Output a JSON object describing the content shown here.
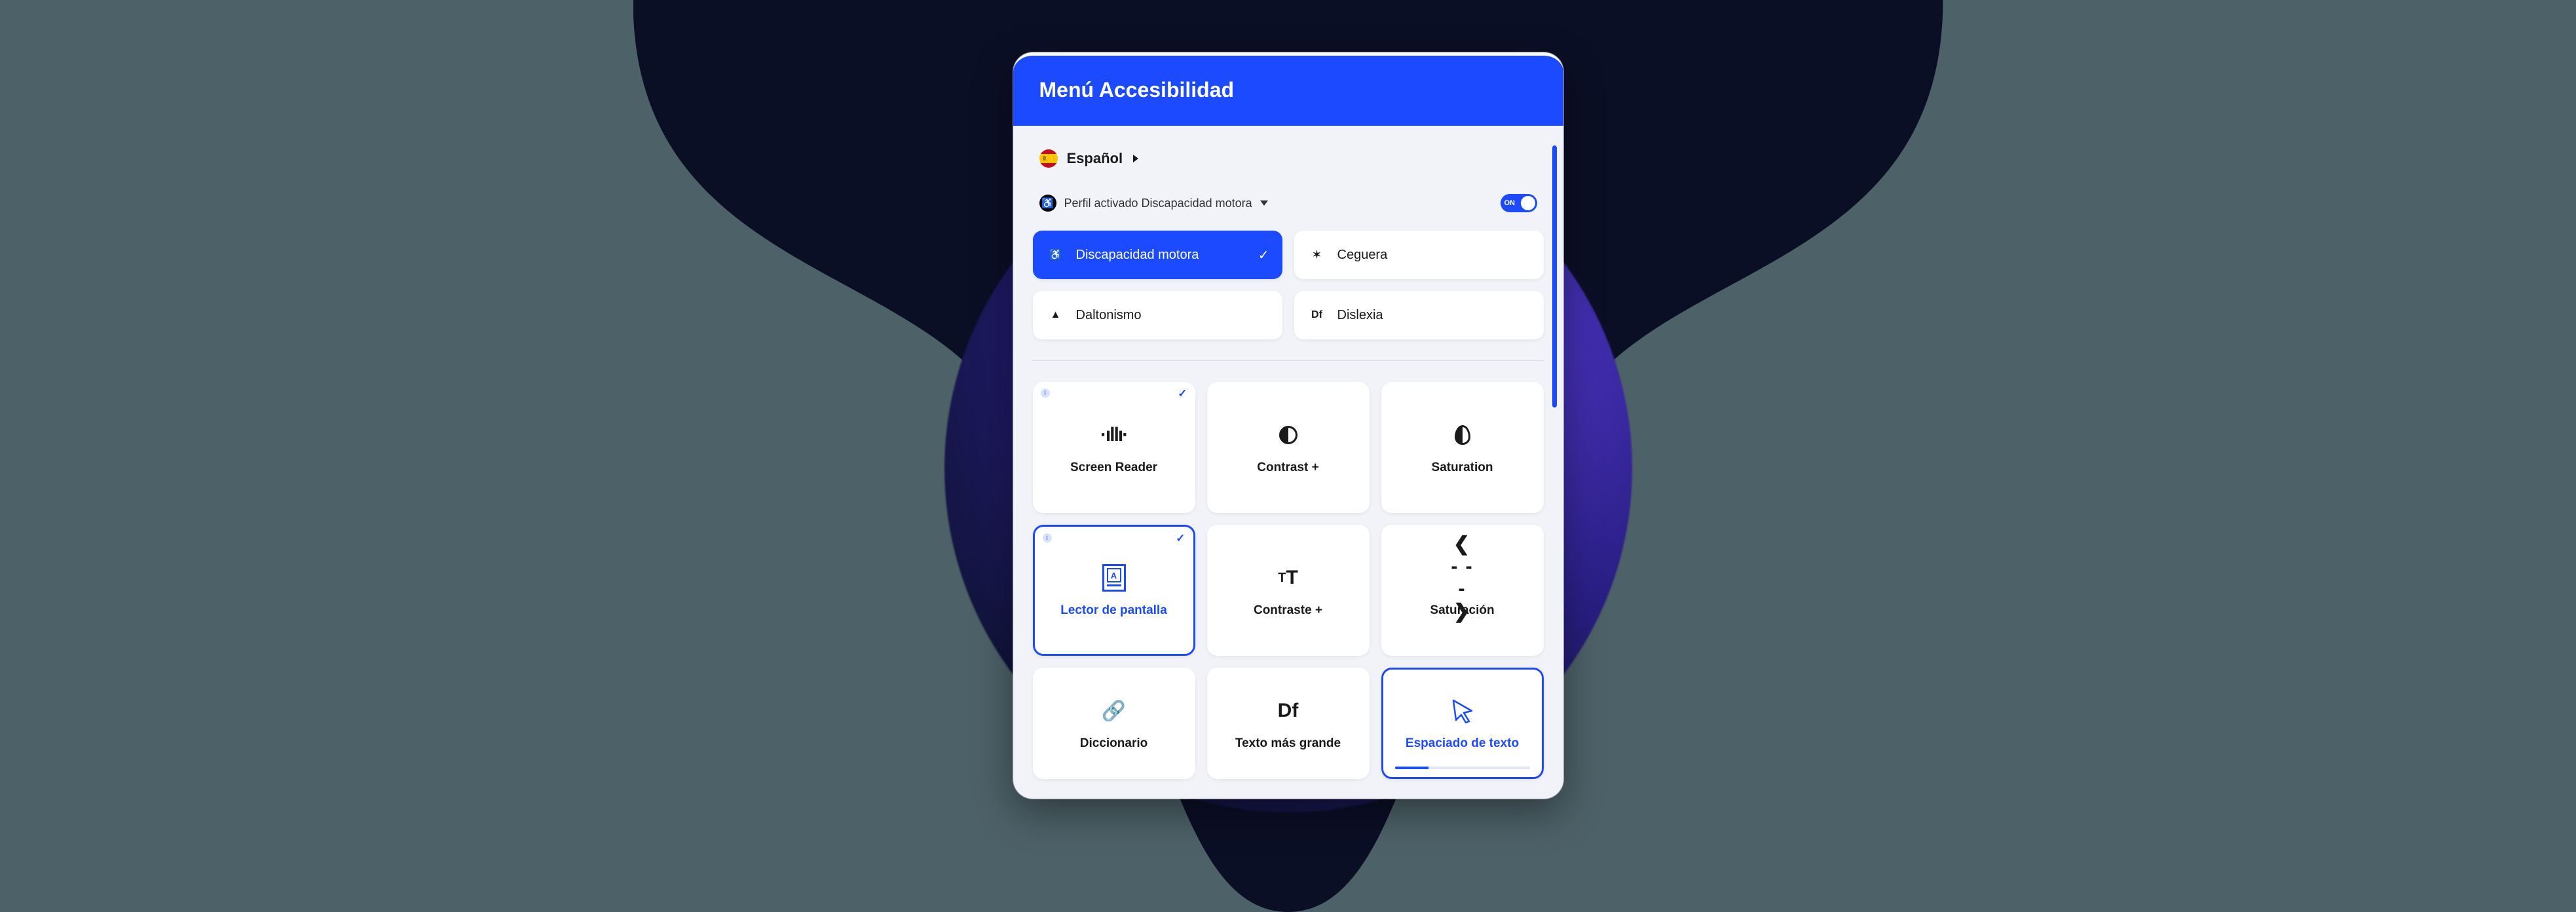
{
  "header": {
    "title": "Menú Accesibilidad"
  },
  "language": {
    "label": "Español"
  },
  "profile_row": {
    "text": "Perfil activado Discapacidad motora",
    "toggle": "ON"
  },
  "profiles": {
    "motor": {
      "label": "Discapacidad motora"
    },
    "blindness": {
      "label": "Ceguera"
    },
    "colorblind": {
      "label": "Daltonismo"
    },
    "dyslexia": {
      "label": "Dislexia"
    }
  },
  "tools": {
    "screenreader_en": {
      "label": "Screen Reader"
    },
    "contrast_en": {
      "label": "Contrast +"
    },
    "saturation_en": {
      "label": "Saturation"
    },
    "screenreader_es": {
      "label": "Lector de pantalla"
    },
    "contrast_es": {
      "label": "Contraste +"
    },
    "saturation_es": {
      "label": "Saturación"
    },
    "dictionary": {
      "label": "Diccionario"
    },
    "bigger_text": {
      "label": "Texto más grande"
    },
    "text_spacing": {
      "label": "Espaciado de texto"
    }
  },
  "colors": {
    "accent": "#1c4bff"
  }
}
